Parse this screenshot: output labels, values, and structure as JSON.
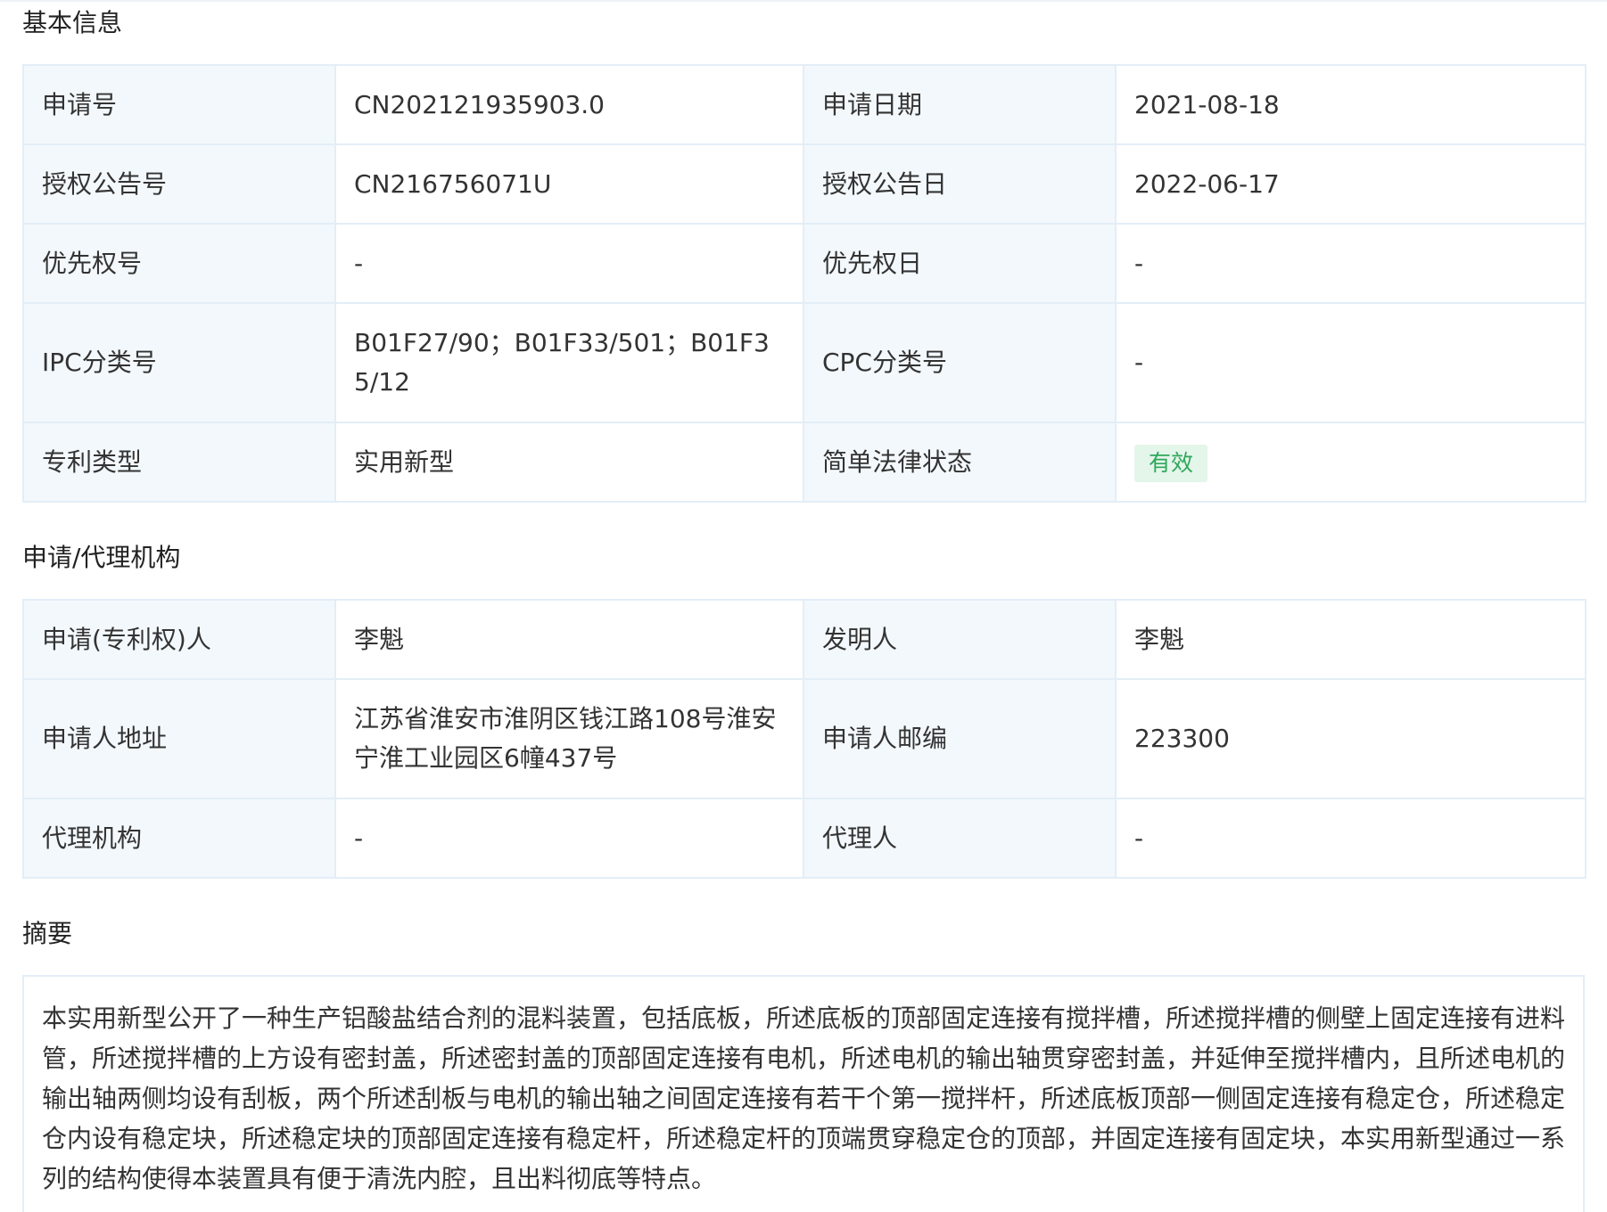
{
  "basic_info": {
    "title": "基本信息",
    "rows": [
      {
        "label1": "申请号",
        "value1": "CN202121935903.0",
        "label2": "申请日期",
        "value2": "2021-08-18"
      },
      {
        "label1": "授权公告号",
        "value1": "CN216756071U",
        "label2": "授权公告日",
        "value2": "2022-06-17"
      },
      {
        "label1": "优先权号",
        "value1": "-",
        "label2": "优先权日",
        "value2": "-"
      },
      {
        "label1": "IPC分类号",
        "value1": "B01F27/90；B01F33/501；B01F35/12",
        "label2": "CPC分类号",
        "value2": "-"
      },
      {
        "label1": "专利类型",
        "value1": "实用新型",
        "label2": "简单法律状态",
        "value2": "有效"
      }
    ],
    "status_color": "#2fa85a",
    "status_bg": "#e4f5ea"
  },
  "agency": {
    "title": "申请/代理机构",
    "rows": [
      {
        "label1": "申请(专利权)人",
        "value1": "李魁",
        "label2": "发明人",
        "value2": "李魁"
      },
      {
        "label1": "申请人地址",
        "value1": "江苏省淮安市淮阴区钱江路108号淮安宁淮工业园区6幢437号",
        "label2": "申请人邮编",
        "value2": "223300"
      },
      {
        "label1": "代理机构",
        "value1": "-",
        "label2": "代理人",
        "value2": "-"
      }
    ]
  },
  "abstract": {
    "title": "摘要",
    "text": "本实用新型公开了一种生产铝酸盐结合剂的混料装置，包括底板，所述底板的顶部固定连接有搅拌槽，所述搅拌槽的侧壁上固定连接有进料管，所述搅拌槽的上方设有密封盖，所述密封盖的顶部固定连接有电机，所述电机的输出轴贯穿密封盖，并延伸至搅拌槽内，且所述电机的输出轴两侧均设有刮板，两个所述刮板与电机的输出轴之间固定连接有若干个第一搅拌杆，所述底板顶部一侧固定连接有稳定仓，所述稳定仓内设有稳定块，所述稳定块的顶部固定连接有稳定杆，所述稳定杆的顶端贯穿稳定仓的顶部，并固定连接有固定块，本实用新型通过一系列的结构使得本装置具有便于清洗内腔，且出料彻底等特点。"
  }
}
